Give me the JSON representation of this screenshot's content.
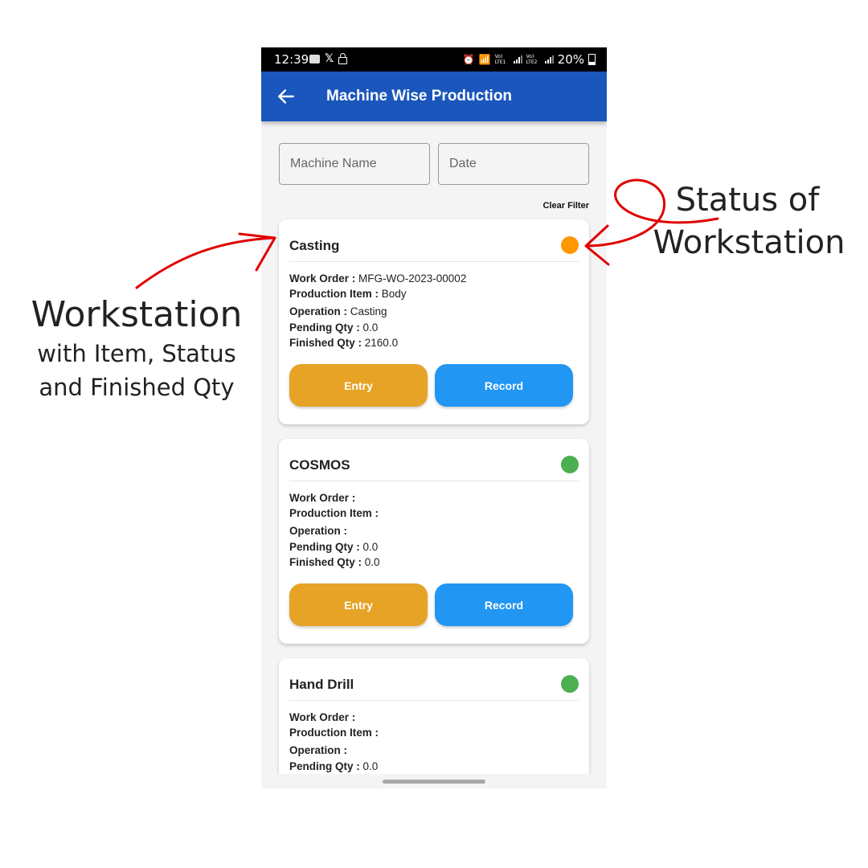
{
  "status_bar": {
    "time": "12:39",
    "left_icons": [
      "app-icon",
      "x-icon",
      "lock-icon"
    ],
    "right_icons": [
      "alarm-icon",
      "wifi-icon",
      "lte1-signal-icon",
      "lte2-signal-icon"
    ],
    "lte1_label": "Vo) LTE1",
    "lte2_label": "Vo) LTE2",
    "battery": "20%"
  },
  "app_bar": {
    "title": "Machine Wise Production",
    "back_icon": "arrow-left-icon"
  },
  "filters": {
    "machine_name_placeholder": "Machine Name",
    "machine_name_value": "",
    "date_placeholder": "Date",
    "date_value": "",
    "clear_label": "Clear Filter"
  },
  "labels": {
    "work_order": "Work Order :",
    "production_item": "Production Item :",
    "operation": "Operation :",
    "pending_qty": "Pending Qty :",
    "finished_qty": "Finished Qty :",
    "entry": "Entry",
    "record": "Record"
  },
  "colors": {
    "app_bar": "#1a56bc",
    "status_in_progress": "#ff9800",
    "status_idle": "#4caf50",
    "entry_button": "#e6a325",
    "record_button": "#2196f3",
    "annotation_arrow": "#e00000"
  },
  "workstations": [
    {
      "name": "Casting",
      "status_color": "#ff9800",
      "work_order": "MFG-WO-2023-00002",
      "production_item": "Body",
      "operation": "Casting",
      "pending_qty": "0.0",
      "finished_qty": "2160.0"
    },
    {
      "name": "COSMOS",
      "status_color": "#4caf50",
      "work_order": "",
      "production_item": "",
      "operation": "",
      "pending_qty": "0.0",
      "finished_qty": "0.0"
    },
    {
      "name": "Hand Drill",
      "status_color": "#4caf50",
      "work_order": "",
      "production_item": "",
      "operation": "",
      "pending_qty": "0.0"
    }
  ],
  "annotations": {
    "left_title": "Workstation",
    "left_line1": "with Item, Status",
    "left_line2": "and Finished Qty",
    "right_line1": "Status of",
    "right_line2": "Workstation"
  }
}
